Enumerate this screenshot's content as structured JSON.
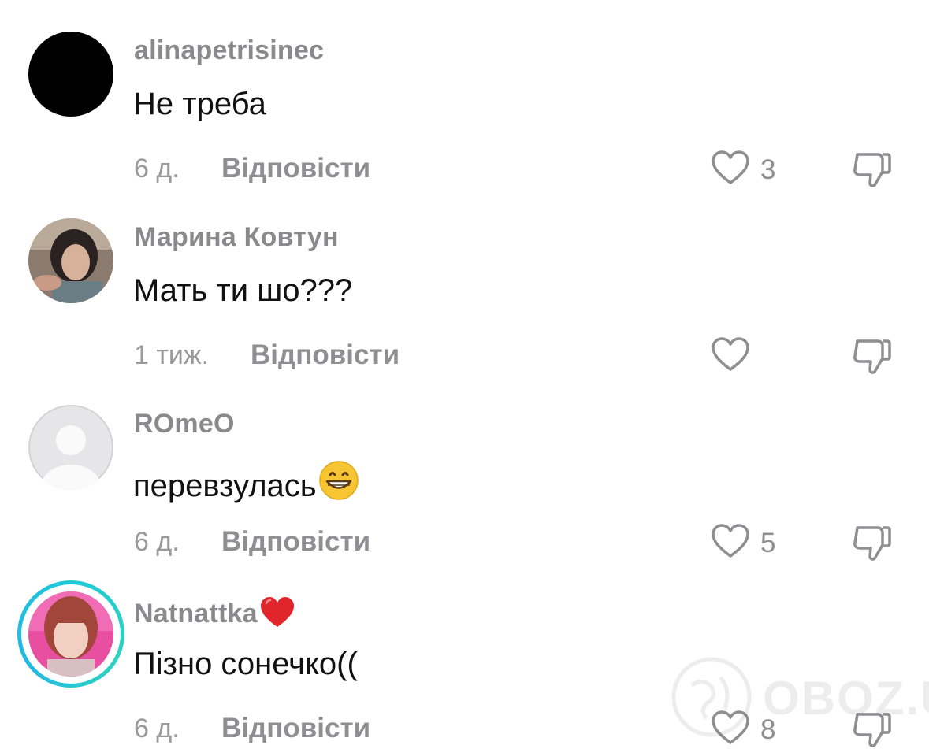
{
  "comments": [
    {
      "username": "alinapetrisinec",
      "text": "Не треба",
      "time": "6 д.",
      "reply_label": "Відповісти",
      "likes": "3",
      "avatar": "black-circle-avatar"
    },
    {
      "username": "Марина Ковтун",
      "text": "Мать ти шо???",
      "time": "1 тиж.",
      "reply_label": "Відповісти",
      "likes": "",
      "avatar": "photo-avatar-woman-dark-hair"
    },
    {
      "username": "ROmeO",
      "text": "перевзулась",
      "time": "6 д.",
      "reply_label": "Відповісти",
      "likes": "5",
      "avatar": "default-grey-avatar",
      "text_emoji": "grinning-face-emoji"
    },
    {
      "username": "Natnattka",
      "username_emoji": "red-heart-emoji",
      "text": "Пізно сонечко((",
      "time": "6 д.",
      "reply_label": "Відповісти",
      "likes": "8",
      "avatar": "photo-avatar-woman-pink-hair-story-ring"
    }
  ],
  "watermark": {
    "text": "OBOZ.UA"
  },
  "colors": {
    "username": "#8a8a8e",
    "text": "#111111",
    "meta": "#9a9a9e",
    "story_ring": "#1ec9d6"
  }
}
